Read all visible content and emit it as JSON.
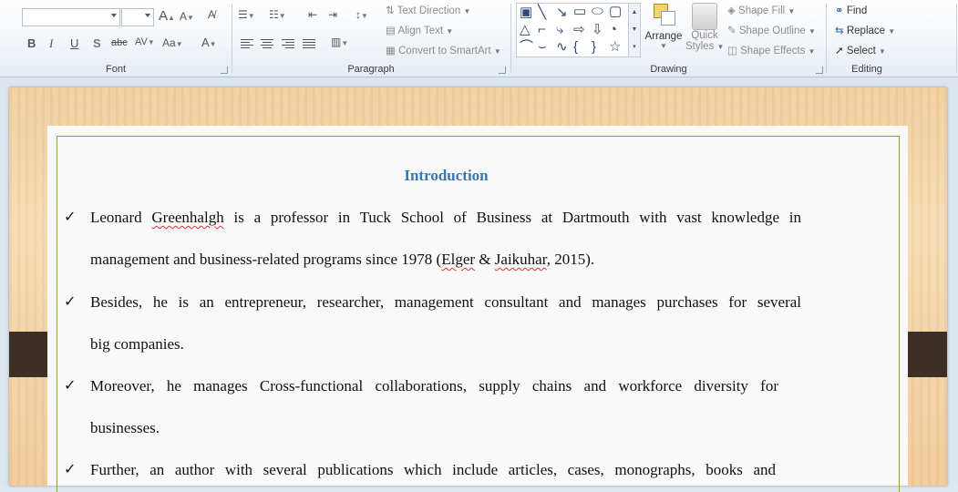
{
  "ribbon": {
    "font": {
      "label": "Font",
      "font_name": "",
      "font_size": "",
      "grow_icon": "A",
      "shrink_icon": "A",
      "bold": "B",
      "italic": "I",
      "underline": "U",
      "shadow": "S",
      "strike": "abc",
      "spacing": "AV",
      "case": "Aa",
      "color": "A"
    },
    "paragraph": {
      "label": "Paragraph",
      "text_direction": "Text Direction",
      "align_text": "Align Text",
      "convert_smartart": "Convert to SmartArt"
    },
    "drawing": {
      "label": "Drawing",
      "arrange": "Arrange",
      "quick_styles_1": "Quick",
      "quick_styles_2": "Styles",
      "shape_fill": "Shape Fill",
      "shape_outline": "Shape Outline",
      "shape_effects": "Shape Effects"
    },
    "editing": {
      "label": "Editing",
      "find": "Find",
      "replace": "Replace",
      "select": "Select"
    }
  },
  "document": {
    "heading": "Introduction",
    "bullet_glyph": "✓",
    "lines": {
      "l1a": "Leonard ",
      "l1b": "Greenhalgh",
      "l1c": "  is a professor in  Tuck School of Business  at Dartmouth  with  vast knowledge  in",
      "l2a": "management  and business-related  programs since  1978  (",
      "l2b": "Elger",
      "l2c": "  &  ",
      "l2d": "Jaikuhar",
      "l2e": ",  2015).",
      "l3": "Besides,  he is an entrepreneur,  researcher,  management  consultant and manages  purchases for several",
      "l4": "big companies.",
      "l5": "Moreover,  he manages  Cross-functional  collaborations,  supply chains and workforce diversity  for",
      "l6": "businesses.",
      "l7": "Further,  an author with  several publications  which include articles,  cases, monographs,  books and"
    }
  }
}
